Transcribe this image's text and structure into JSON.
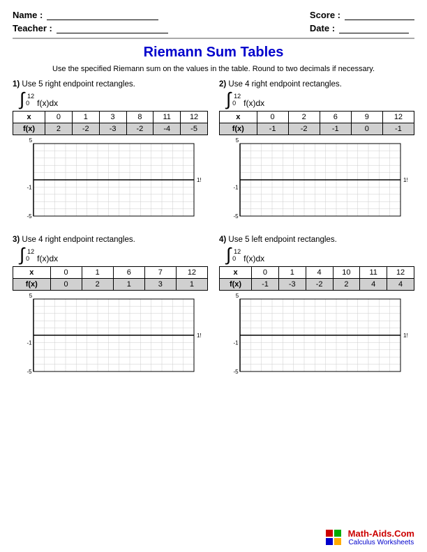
{
  "header": {
    "name_label": "Name :",
    "teacher_label": "Teacher :",
    "score_label": "Score :",
    "date_label": "Date :"
  },
  "title": "Riemann Sum Tables",
  "instructions": "Use the specified Riemann sum on the values in the table. Round to two decimals if necessary.",
  "problems": [
    {
      "number": "1)",
      "description": "Use 5 right endpoint rectangles.",
      "integral_top": "12",
      "integral_bottom": "0",
      "integral_expr": "f(x)dx",
      "x_values": [
        "x",
        "0",
        "1",
        "3",
        "8",
        "11",
        "12"
      ],
      "fx_values": [
        "f(x)",
        "2",
        "-2",
        "-3",
        "-2",
        "-4",
        "-5"
      ]
    },
    {
      "number": "2)",
      "description": "Use 4 right endpoint rectangles.",
      "integral_top": "12",
      "integral_bottom": "0",
      "integral_expr": "f(x)dx",
      "x_values": [
        "x",
        "0",
        "2",
        "6",
        "9",
        "12"
      ],
      "fx_values": [
        "f(x)",
        "-1",
        "-2",
        "-1",
        "0",
        "-1"
      ]
    },
    {
      "number": "3)",
      "description": "Use 4 right endpoint rectangles.",
      "integral_top": "12",
      "integral_bottom": "0",
      "integral_expr": "f(x)dx",
      "x_values": [
        "x",
        "0",
        "1",
        "6",
        "7",
        "12"
      ],
      "fx_values": [
        "f(x)",
        "0",
        "2",
        "1",
        "3",
        "1"
      ]
    },
    {
      "number": "4)",
      "description": "Use 5 left endpoint rectangles.",
      "integral_top": "12",
      "integral_bottom": "0",
      "integral_expr": "f(x)dx",
      "x_values": [
        "x",
        "0",
        "1",
        "4",
        "10",
        "11",
        "12"
      ],
      "fx_values": [
        "f(x)",
        "-1",
        "-3",
        "-2",
        "2",
        "4",
        "4"
      ]
    }
  ],
  "footer": {
    "site": "Math-Aids.Com",
    "sub": "Calculus Worksheets"
  }
}
